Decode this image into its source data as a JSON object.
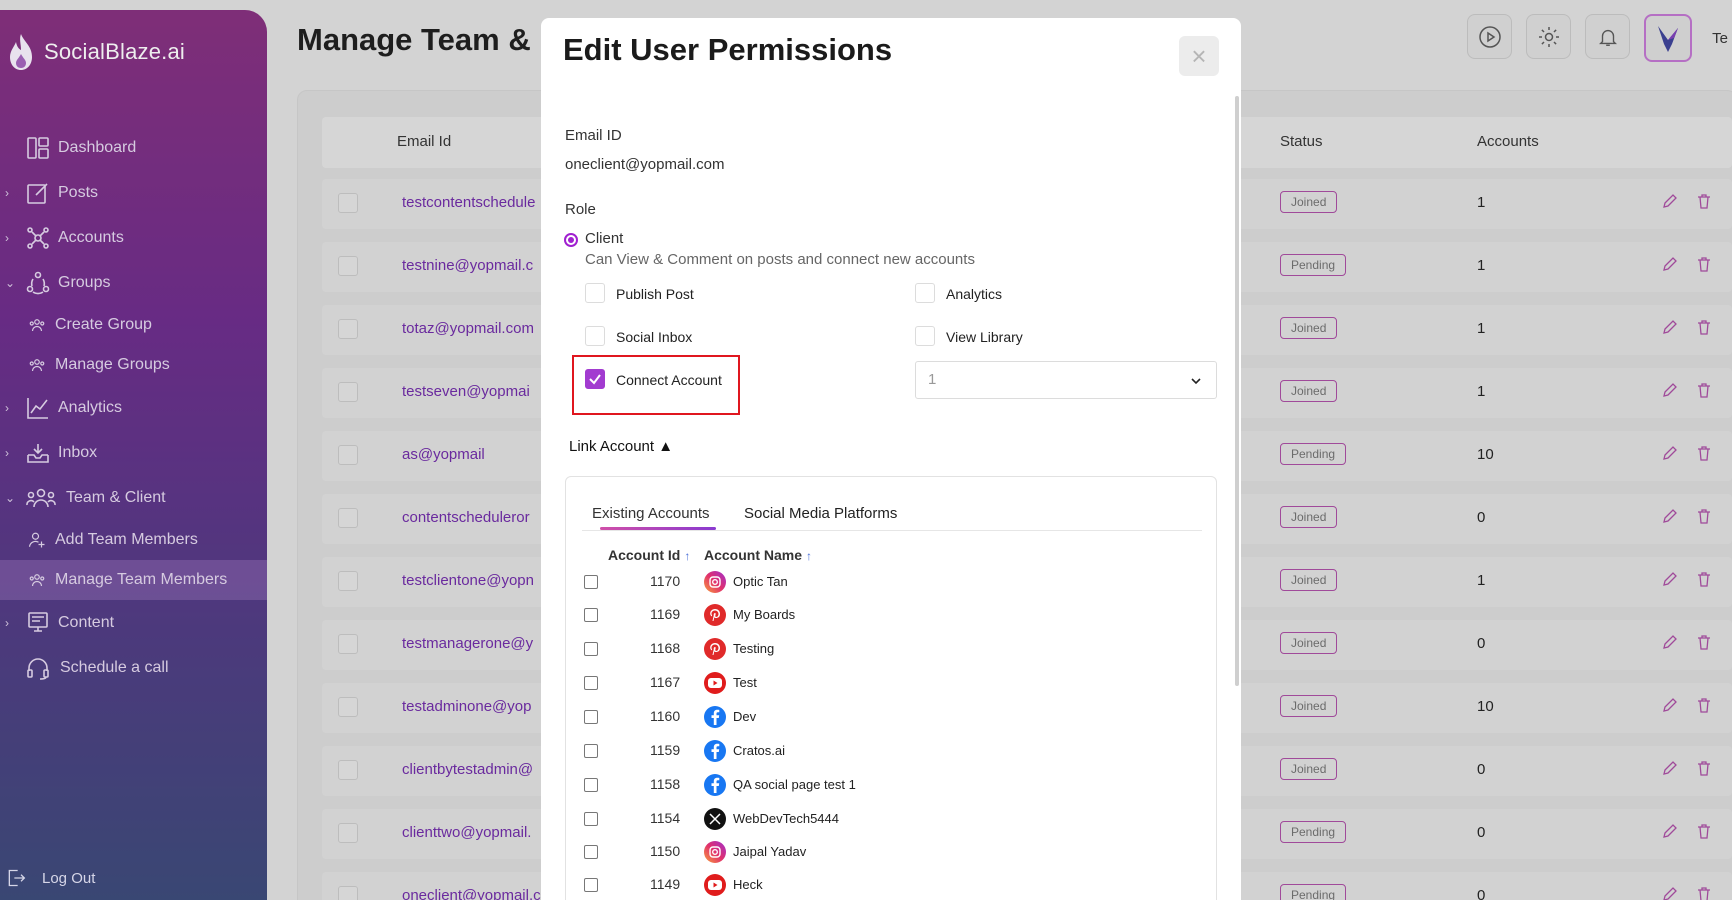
{
  "brand": {
    "name": "SocialBlaze.ai"
  },
  "sidebar": {
    "items": [
      {
        "label": "Dashboard",
        "icon": "dashboard-icon",
        "chevron": ""
      },
      {
        "label": "Posts",
        "icon": "edit-square-icon",
        "chevron": "›"
      },
      {
        "label": "Accounts",
        "icon": "network-icon",
        "chevron": "›"
      },
      {
        "label": "Groups",
        "icon": "group-icon",
        "chevron": "⌄"
      },
      {
        "label": "Create Group",
        "icon": "users-icon",
        "chevron": ""
      },
      {
        "label": "Manage Groups",
        "icon": "users-icon",
        "chevron": ""
      },
      {
        "label": "Analytics",
        "icon": "chart-line-icon",
        "chevron": "›"
      },
      {
        "label": "Inbox",
        "icon": "inbox-icon",
        "chevron": "›"
      },
      {
        "label": "Team & Client",
        "icon": "team-icon",
        "chevron": "⌄"
      },
      {
        "label": "Add Team Members",
        "icon": "user-add-icon",
        "chevron": ""
      },
      {
        "label": "Manage Team Members",
        "icon": "users-icon",
        "chevron": ""
      },
      {
        "label": "Content",
        "icon": "content-icon",
        "chevron": "›"
      },
      {
        "label": "Schedule a call",
        "icon": "headset-icon",
        "chevron": ""
      }
    ],
    "logout": "Log Out"
  },
  "page": {
    "title": "Manage Team &",
    "avatar_text": "Te"
  },
  "table": {
    "headers": {
      "email": "Email Id",
      "status": "Status",
      "accounts": "Accounts"
    },
    "rows": [
      {
        "email": "testcontentschedule",
        "status": "Joined",
        "accounts": "1"
      },
      {
        "email": "testnine@yopmail.c",
        "status": "Pending",
        "accounts": "1"
      },
      {
        "email": "totaz@yopmail.com",
        "status": "Joined",
        "accounts": "1"
      },
      {
        "email": "testseven@yopmai",
        "status": "Joined",
        "accounts": "1"
      },
      {
        "email": "as@yopmail",
        "status": "Pending",
        "accounts": "10"
      },
      {
        "email": "contentscheduleror",
        "status": "Joined",
        "accounts": "0"
      },
      {
        "email": "testclientone@yopn",
        "status": "Joined",
        "accounts": "1"
      },
      {
        "email": "testmanagerone@y",
        "status": "Joined",
        "accounts": "0"
      },
      {
        "email": "testadminone@yop",
        "status": "Joined",
        "accounts": "10"
      },
      {
        "email": "clientbytestadmin@",
        "status": "Joined",
        "accounts": "0"
      },
      {
        "email": "clienttwo@yopmail.",
        "status": "Pending",
        "accounts": "0"
      },
      {
        "email": "oneclient@yopmail.c",
        "status": "Pending",
        "accounts": "0"
      }
    ]
  },
  "modal": {
    "title": "Edit User Permissions",
    "close": "×",
    "email_label": "Email ID",
    "email_value": "oneclient@yopmail.com",
    "role_label": "Role",
    "role_value": "Client",
    "role_desc": "Can View & Comment on posts and connect new accounts",
    "permissions": {
      "publish_post": "Publish Post",
      "analytics": "Analytics",
      "social_inbox": "Social Inbox",
      "view_library": "View Library",
      "connect_account": "Connect Account"
    },
    "connect_account_checked": true,
    "select_value": "1",
    "link_account": "Link Account ▲",
    "tabs": [
      "Existing Accounts",
      "Social Media Platforms"
    ],
    "columns": {
      "id": "Account Id",
      "name": "Account Name",
      "sort": "↑"
    },
    "accounts": [
      {
        "id": "1170",
        "name": "Optic Tan",
        "platform": "instagram"
      },
      {
        "id": "1169",
        "name": "My Boards",
        "platform": "pinterest"
      },
      {
        "id": "1168",
        "name": "Testing",
        "platform": "pinterest"
      },
      {
        "id": "1167",
        "name": "Test",
        "platform": "youtube"
      },
      {
        "id": "1160",
        "name": "Dev",
        "platform": "facebook"
      },
      {
        "id": "1159",
        "name": "Cratos.ai",
        "platform": "facebook"
      },
      {
        "id": "1158",
        "name": "QA social page test 1",
        "platform": "facebook"
      },
      {
        "id": "1154",
        "name": "WebDevTech5444",
        "platform": "x"
      },
      {
        "id": "1150",
        "name": "Jaipal Yadav",
        "platform": "instagram"
      },
      {
        "id": "1149",
        "name": "Heck",
        "platform": "youtube"
      }
    ]
  },
  "colors": {
    "accent": "#a23bd0",
    "highlight": "#e0161f"
  }
}
